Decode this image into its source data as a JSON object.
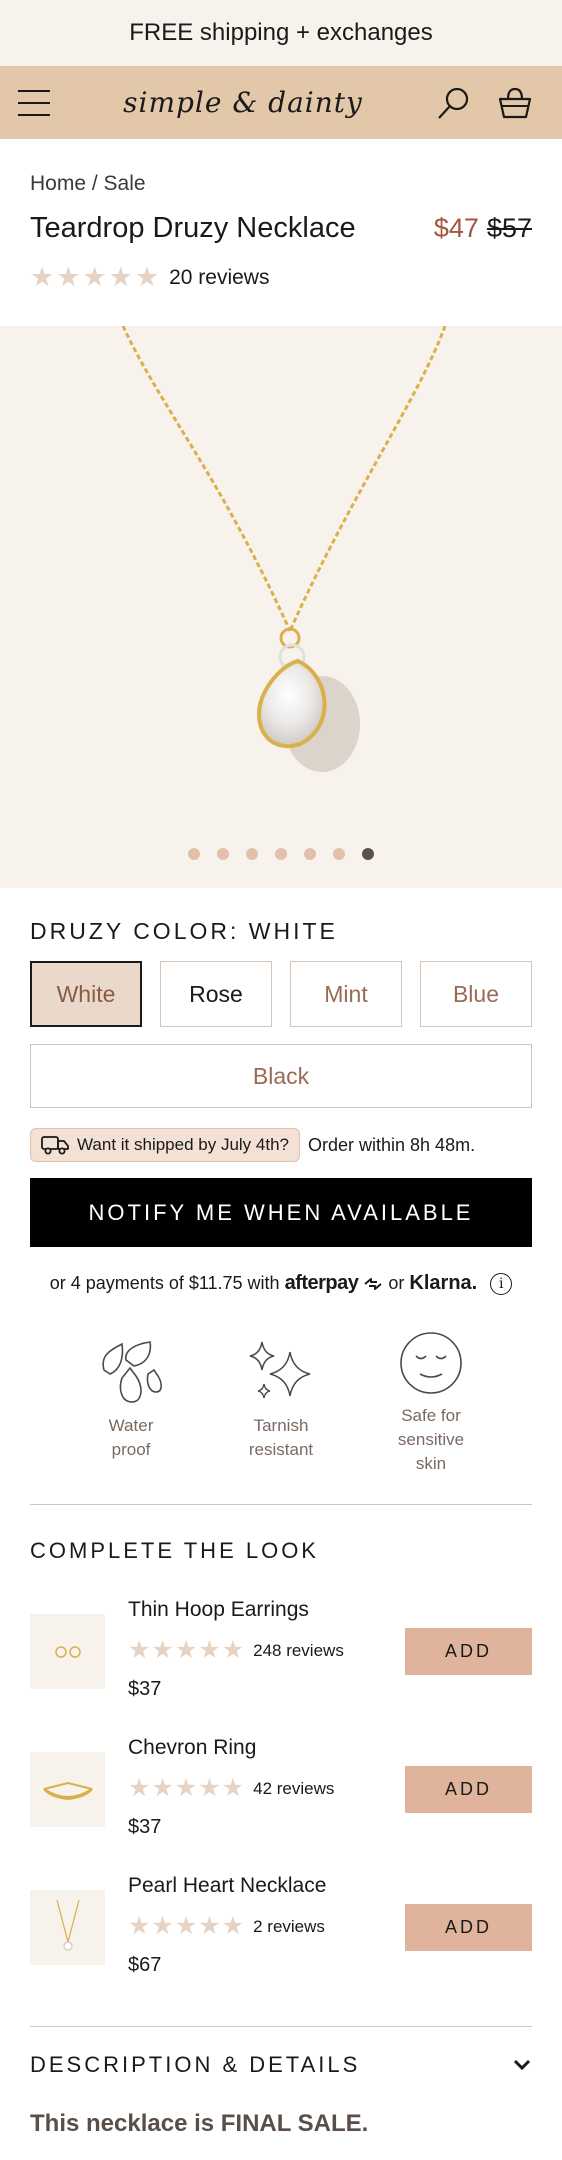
{
  "announcement": "FREE shipping + exchanges",
  "header": {
    "logo": "simple & dainty",
    "icons": [
      "menu-icon",
      "search-icon",
      "basket-icon"
    ]
  },
  "breadcrumb": "Home / Sale",
  "product": {
    "title": "Teardrop Druzy Necklace",
    "price": "$47",
    "compare_price": "$57",
    "reviews": "20 reviews",
    "rating_stars": 5
  },
  "gallery": {
    "slide_count": 7,
    "active_slide": 7
  },
  "options": {
    "label": "DRUZY COLOR: WHITE",
    "colors": [
      "White",
      "Rose",
      "Mint",
      "Blue"
    ],
    "color_black": "Black",
    "selected": "White"
  },
  "shipping": {
    "badge": "Want it shipped by July 4th?",
    "countdown": "Order within 8h 48m."
  },
  "cta": "NOTIFY ME WHEN AVAILABLE",
  "payments": {
    "prefix": "or 4 payments of $11.75 with",
    "afterpay": "afterpay",
    "or": "or",
    "klarna": "Klarna."
  },
  "features": [
    {
      "icon": "water-drops-icon",
      "line1": "Water",
      "line2": "proof",
      "line3": ""
    },
    {
      "icon": "sparkle-icon",
      "line1": "Tarnish",
      "line2": "resistant",
      "line3": ""
    },
    {
      "icon": "calm-face-icon",
      "line1": "Safe for",
      "line2": "sensitive",
      "line3": "skin"
    }
  ],
  "complete_look": {
    "title": "COMPLETE THE LOOK",
    "items": [
      {
        "name": "Thin Hoop Earrings",
        "reviews": "248 reviews",
        "price": "$37",
        "button": "ADD"
      },
      {
        "name": "Chevron Ring",
        "reviews": "42 reviews",
        "price": "$37",
        "button": "ADD"
      },
      {
        "name": "Pearl Heart Necklace",
        "reviews": "2 reviews",
        "price": "$67",
        "button": "ADD"
      }
    ]
  },
  "description": {
    "title": "DESCRIPTION & DETAILS",
    "final_sale": "This necklace is FINAL SALE."
  },
  "colors": {
    "header_bg": "#e3c7a9",
    "cream": "#f7f2ec",
    "price_red": "#a5553b",
    "add_button": "#e0b49c",
    "star": "#e6d3c4"
  }
}
